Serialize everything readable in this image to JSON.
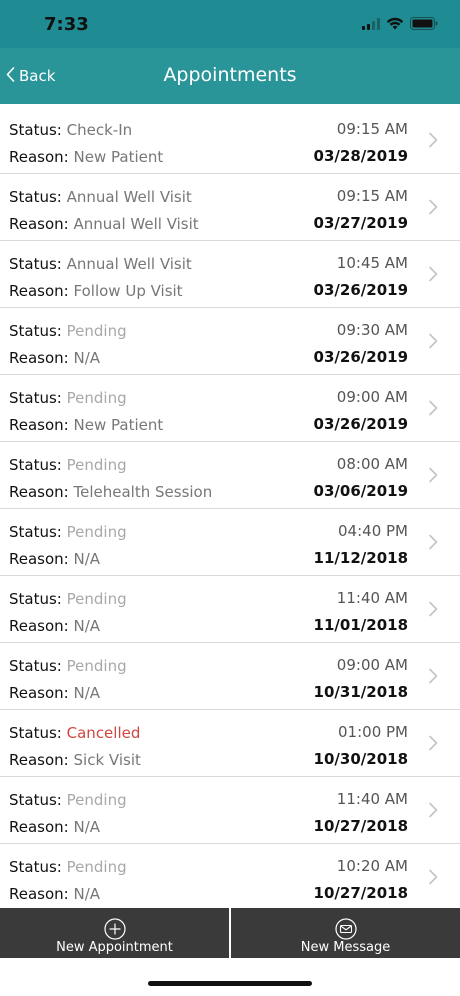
{
  "status_bar": {
    "time": "7:33",
    "icons": [
      "signal-icon",
      "wifi-icon",
      "battery-icon"
    ]
  },
  "nav": {
    "back_label": "Back",
    "title": "Appointments"
  },
  "labels": {
    "status": "Status:",
    "reason": "Reason:"
  },
  "appointments": [
    {
      "status": "Check-In",
      "status_type": "normal",
      "reason": "New Patient",
      "time": "09:15 AM",
      "date": "03/28/2019"
    },
    {
      "status": "Annual Well Visit",
      "status_type": "normal",
      "reason": "Annual Well Visit",
      "time": "09:15 AM",
      "date": "03/27/2019"
    },
    {
      "status": "Annual Well Visit",
      "status_type": "normal",
      "reason": "Follow Up Visit",
      "time": "10:45 AM",
      "date": "03/26/2019"
    },
    {
      "status": "Pending",
      "status_type": "pending",
      "reason": "N/A",
      "time": "09:30 AM",
      "date": "03/26/2019"
    },
    {
      "status": "Pending",
      "status_type": "pending",
      "reason": "New Patient",
      "time": "09:00 AM",
      "date": "03/26/2019"
    },
    {
      "status": "Pending",
      "status_type": "pending",
      "reason": "Telehealth Session",
      "time": "08:00 AM",
      "date": "03/06/2019"
    },
    {
      "status": "Pending",
      "status_type": "pending",
      "reason": "N/A",
      "time": "04:40 PM",
      "date": "11/12/2018"
    },
    {
      "status": "Pending",
      "status_type": "pending",
      "reason": "N/A",
      "time": "11:40 AM",
      "date": "11/01/2018"
    },
    {
      "status": "Pending",
      "status_type": "pending",
      "reason": "N/A",
      "time": "09:00 AM",
      "date": "10/31/2018"
    },
    {
      "status": "Cancelled",
      "status_type": "cancelled",
      "reason": "Sick Visit",
      "time": "01:00 PM",
      "date": "10/30/2018"
    },
    {
      "status": "Pending",
      "status_type": "pending",
      "reason": "N/A",
      "time": "11:40 AM",
      "date": "10/27/2018"
    },
    {
      "status": "Pending",
      "status_type": "pending",
      "reason": "N/A",
      "time": "10:20 AM",
      "date": "10/27/2018"
    }
  ],
  "tab_bar": {
    "new_appointment": {
      "label": "New Appointment",
      "icon": "plus-circle-icon"
    },
    "new_message": {
      "label": "New Message",
      "icon": "mail-circle-icon"
    }
  },
  "colors": {
    "status_bar_bg": "#1f8c94",
    "nav_bg": "#2a9599",
    "tab_bar_bg": "#3a3a3a",
    "cancelled": "#d0463f",
    "pending": "#a8a8a8"
  }
}
